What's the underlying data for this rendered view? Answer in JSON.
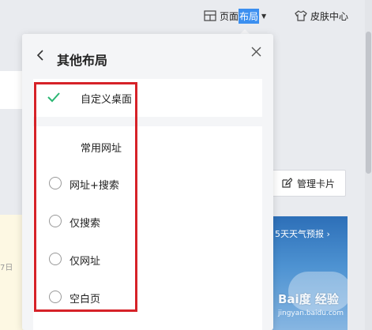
{
  "topbar": {
    "layout_label_part1": "页面",
    "layout_label_part2": "布局",
    "skin_label": "皮肤中心",
    "layout_icon": "layout-grid-icon",
    "skin_icon": "shirt-icon"
  },
  "panel": {
    "title": "其他布局",
    "back_icon": "chevron-left-icon",
    "close_icon": "close-icon",
    "custom_option": {
      "label": "自定义桌面",
      "selected": true,
      "icon": "checkmark-icon"
    },
    "common_section_title": "常用网址",
    "options": [
      {
        "label": "网址+搜索",
        "selected": false
      },
      {
        "label": "仅搜索",
        "selected": false
      },
      {
        "label": "仅网址",
        "selected": false
      },
      {
        "label": "空白页",
        "selected": false
      }
    ]
  },
  "background": {
    "manage_card_label": "管理卡片",
    "manage_card_icon": "edit-icon",
    "weather_title": "5天天气预报",
    "weather_chevron": "chevron-right-icon",
    "left_partial_text": "7日"
  },
  "watermark": {
    "logo_text": "Bai度 经验",
    "url": "jingyan.baidu.com"
  },
  "colors": {
    "accent_blue": "#3b8ff0",
    "check_green": "#2bb673",
    "highlight_red": "#d62228",
    "panel_bg": "#f4f5f7"
  }
}
